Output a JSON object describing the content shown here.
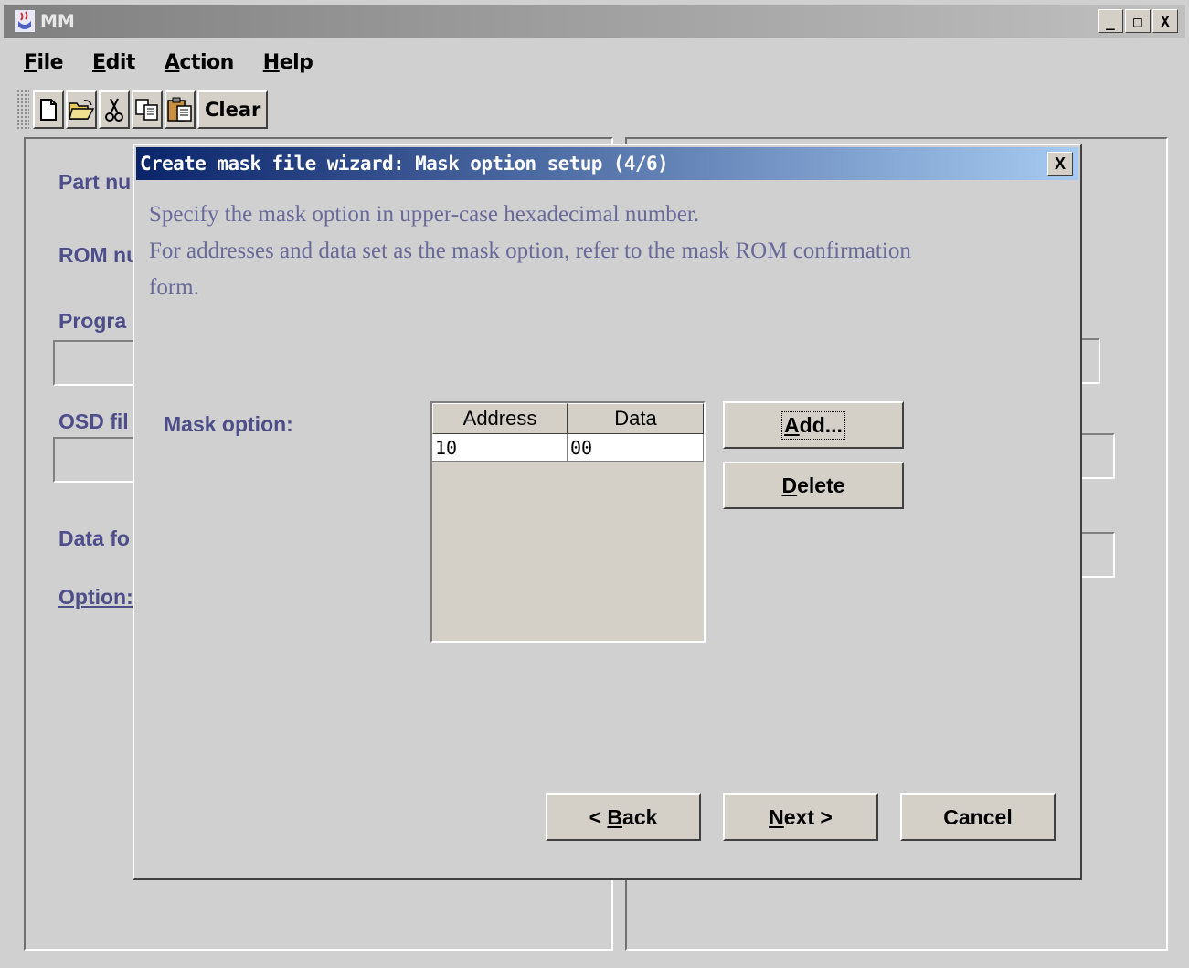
{
  "window": {
    "title": "MM",
    "minimize_label": "_",
    "maximize_label": "□",
    "close_label": "X"
  },
  "menubar": [
    {
      "mnemonic": "F",
      "rest": "ile"
    },
    {
      "mnemonic": "E",
      "rest": "dit"
    },
    {
      "mnemonic": "A",
      "rest": "ction"
    },
    {
      "mnemonic": "H",
      "rest": "elp"
    }
  ],
  "toolbar": {
    "clear_label": "Clear"
  },
  "background": {
    "labels": [
      "Part nu",
      "ROM nu",
      "Progra",
      "OSD fil",
      "Data fo",
      "Option:"
    ]
  },
  "dialog": {
    "title": "Create mask file wizard: Mask option setup (4/6)",
    "close_label": "X",
    "description_line1": "Specify the mask option in upper-case hexadecimal number.",
    "description_line2": "For addresses and data set as the mask option, refer to the mask ROM confirmation",
    "description_line3": "form.",
    "mask_option_label": "Mask option:",
    "table": {
      "headers": [
        "Address",
        "Data"
      ],
      "rows": [
        [
          "10",
          "00"
        ]
      ]
    },
    "add_button": {
      "mnemonic": "A",
      "rest": "dd..."
    },
    "delete_button": {
      "mnemonic": "D",
      "rest": "elete"
    },
    "back_button": {
      "pre": "< ",
      "mnemonic": "B",
      "rest": "ack"
    },
    "next_button": {
      "mnemonic": "N",
      "rest": "ext >"
    },
    "cancel_button": "Cancel"
  }
}
